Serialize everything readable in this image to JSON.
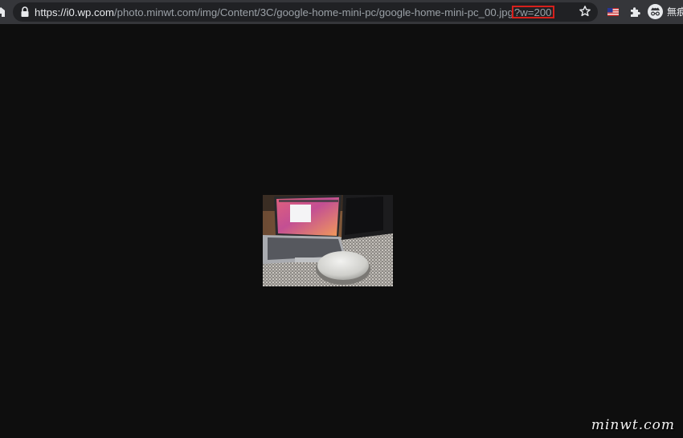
{
  "browser": {
    "url_host": "https://i0.wp.com",
    "url_path": "/photo.minwt.com/img/Content/3C/google-home-mini-pc/google-home-mini-pc_00.jpg",
    "url_query": "?w=200",
    "profile_label": "無痕"
  },
  "icons": {
    "home": "home-icon",
    "lock": "lock-icon",
    "star": "star-icon",
    "flag": "us-flag-icon",
    "extensions": "puzzle-icon",
    "incognito": "incognito-icon"
  },
  "colors": {
    "toolbar": "#35363a",
    "omnibox": "#202124",
    "page_background": "#0e0e0e",
    "highlight_box": "#d6201c"
  },
  "watermark": "minwt.com"
}
